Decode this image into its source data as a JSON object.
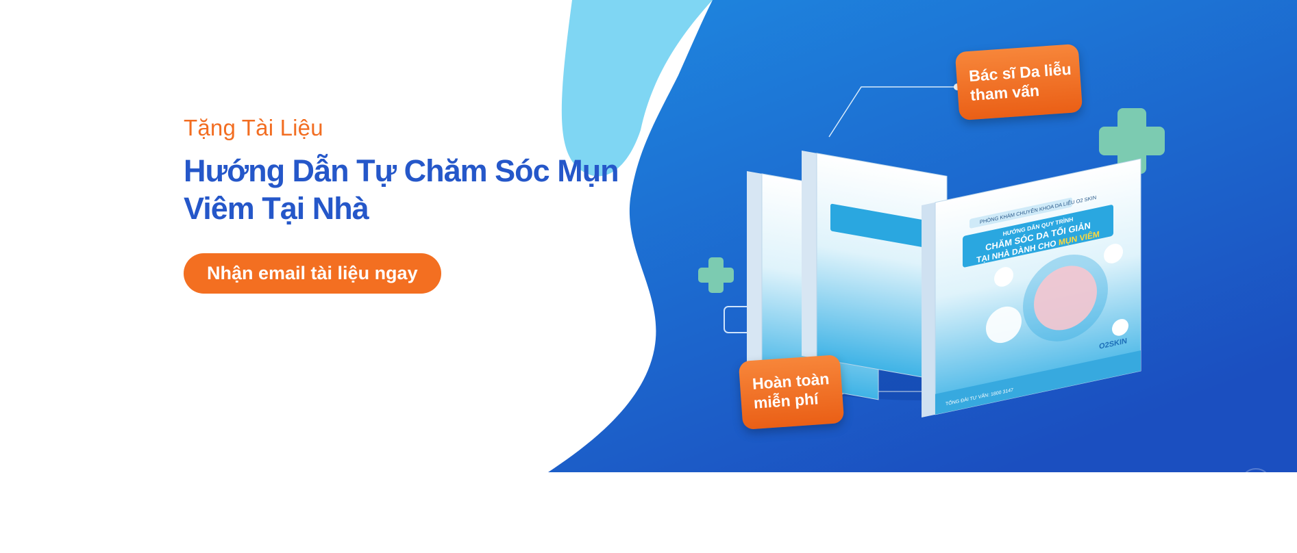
{
  "eyebrow": "Tặng Tài Liệu",
  "headline": {
    "line1": "Hướng Dẫn Tự Chăm Sóc Mụn",
    "line2": "Viêm Tại Nhà"
  },
  "cta_label": "Nhận email tài liệu ngay",
  "badges": {
    "top": {
      "line1": "Bác sĩ Da liễu",
      "line2": "tham vấn"
    },
    "bottom": {
      "line1": "Hoàn toàn",
      "line2": "miễn phí"
    }
  },
  "book": {
    "clinic": "PHÒNG KHÁM CHUYÊN KHOA DA LIỄU O2 SKIN",
    "subtitle": "HƯỚNG DẪN QUY TRÌNH",
    "title_line1": "CHĂM SÓC DA TỐI GIẢN",
    "title_line2_prefix": "TẠI NHÀ DÀNH CHO ",
    "title_highlight": "MỤN VIÊM",
    "brand": "O2SKIN",
    "hotline": "TỔNG ĐÀI TƯ VẤN: 1800 3147"
  },
  "colors": {
    "accent_orange": "#f26d21",
    "headline_blue": "#2557c9",
    "bg_blue_dark": "#1a4fc2",
    "bg_blue_light": "#7fd6f3",
    "plus_green": "#7ccbb1"
  }
}
